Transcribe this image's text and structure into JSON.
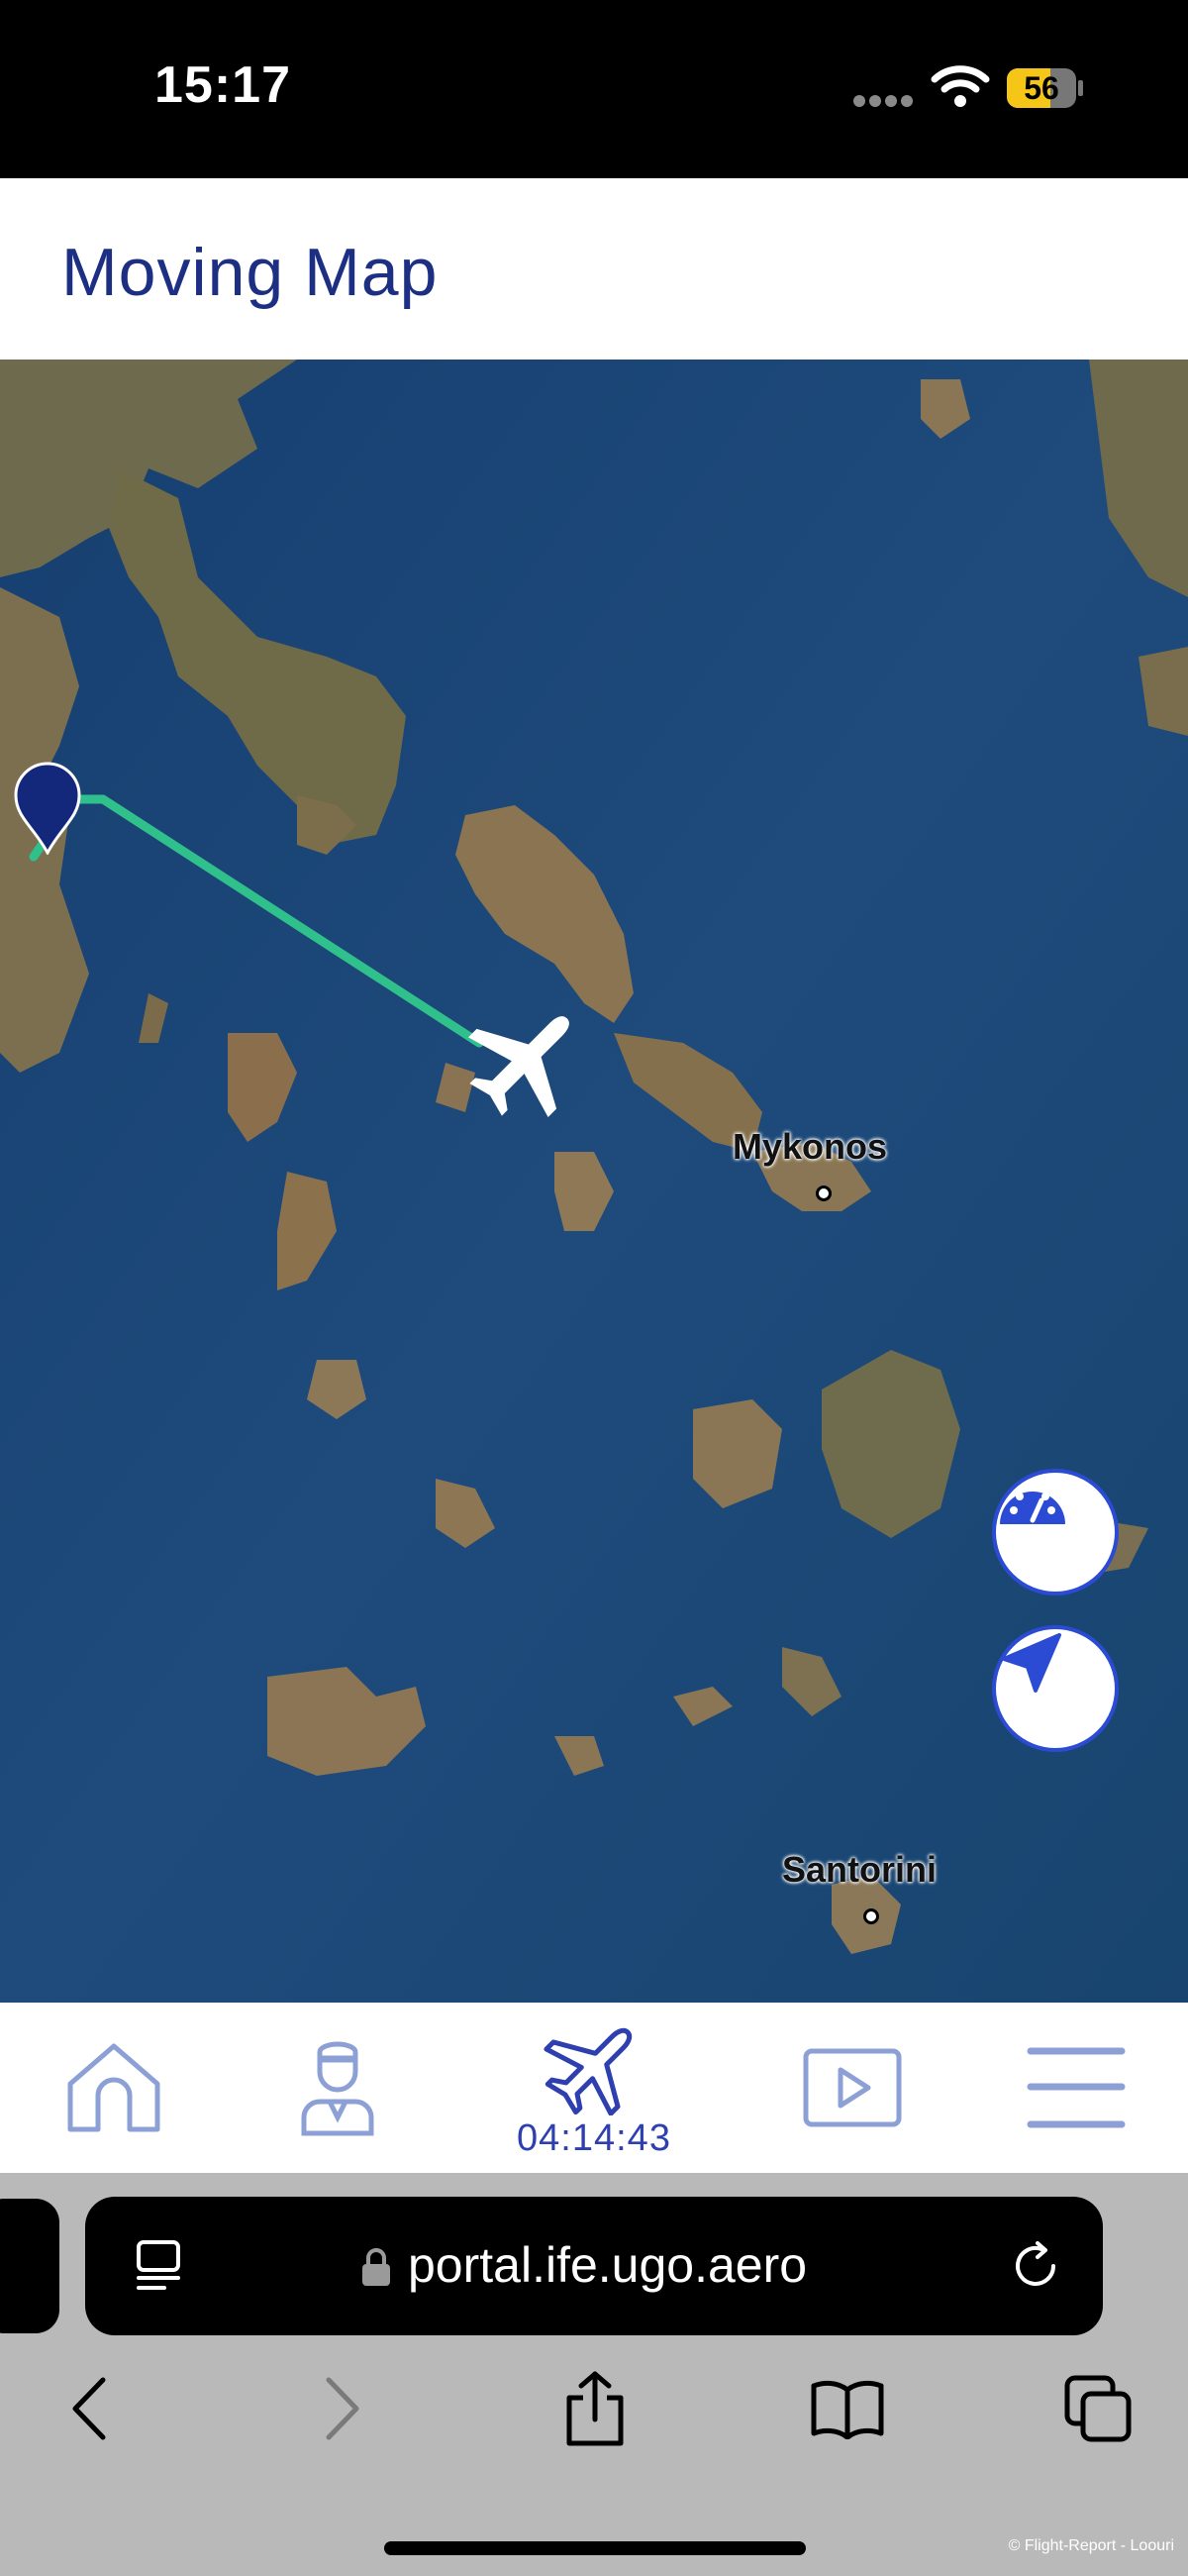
{
  "status_bar": {
    "time": "15:17",
    "battery_level": "56",
    "icons": [
      "cellular-signal-icon",
      "wifi-icon",
      "battery-icon"
    ],
    "battery_color": "#f5c518"
  },
  "header": {
    "title": "Moving Map"
  },
  "map": {
    "labels": {
      "mykonos": "Mykonos",
      "santorini": "Santorini"
    },
    "route_color": "#2fc08c",
    "origin_pin_color": "#13287a",
    "buttons": {
      "speed": "speedometer-icon",
      "locate": "navigation-arrow-icon"
    }
  },
  "bottom_nav": {
    "items": [
      "home-icon",
      "crew-icon",
      "plane-icon",
      "play-icon",
      "menu-icon"
    ],
    "flight_time": "04:14:43",
    "accent": "#2e3fb0"
  },
  "browser": {
    "url": "portal.ife.ugo.aero",
    "toolbar": [
      "back-icon",
      "forward-icon",
      "share-icon",
      "bookmarks-icon",
      "tabs-icon"
    ]
  },
  "watermark": "© Flight-Report - Loouri"
}
